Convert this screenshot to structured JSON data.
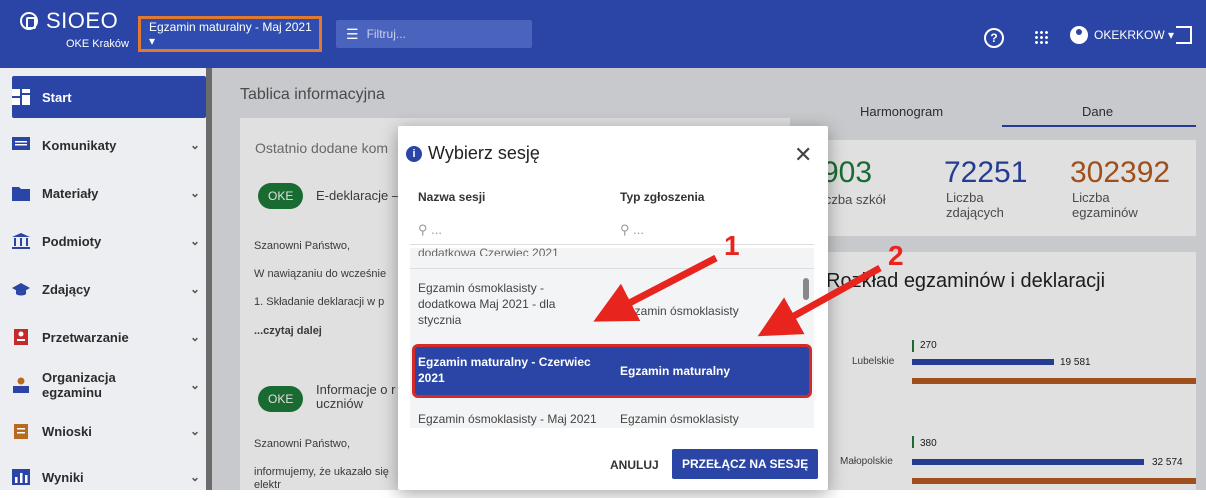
{
  "topbar": {
    "logo_title": "SIOEO",
    "logo_sub": "OKE Kraków",
    "session": "Egzamin maturalny - Maj 2021 ▾",
    "filter_placeholder": "Filtruj...",
    "help_label": "?",
    "user": "OKEKRKOW ▾"
  },
  "sidebar": {
    "items": [
      {
        "label": "Start",
        "icon": "dashboard-icon"
      },
      {
        "label": "Komunikaty",
        "icon": "message-icon"
      },
      {
        "label": "Materiały",
        "icon": "folder-icon"
      },
      {
        "label": "Podmioty",
        "icon": "institution-icon"
      },
      {
        "label": "Zdający",
        "icon": "graduation-icon"
      },
      {
        "label": "Przetwarzanie",
        "icon": "processing-icon"
      },
      {
        "label": "Organizacja egzaminu",
        "icon": "organization-icon"
      },
      {
        "label": "Wnioski",
        "icon": "clipboard-icon"
      },
      {
        "label": "Wyniki",
        "icon": "chart-icon"
      }
    ]
  },
  "main": {
    "title": "Tablica informacyjna",
    "recent": "Ostatnio dodane kom",
    "news1_badge": "OKE",
    "news1_title": "E-deklaracje –",
    "news1_l1": "Szanowni Państwo,",
    "news1_l2": "W nawiązaniu do wcześnie",
    "news1_l3": "1. Składanie deklaracji w p",
    "news1_more": "...czytaj dalej",
    "news2_badge": "OKE",
    "news2_title1": "Informacje o r",
    "news2_title2": "uczniów",
    "news2_l1": "Szanowni Państwo,",
    "news2_l2": "informujemy, że ukazało się",
    "news2_l3": "elektr"
  },
  "right": {
    "tab1": "Harmonogram",
    "tab2": "Dane",
    "stat1_num": "903",
    "stat1_lbl": "iczba szkół",
    "stat2_num": "72251",
    "stat2_lbl": "Liczba zdających",
    "stat3_num": "302392",
    "stat3_lbl": "Liczba egzaminów",
    "chart_title": "Rozkład egzaminów i deklaracji",
    "r1": "Lubelskie",
    "r1a": "270",
    "r1b": "19 581",
    "r2": "Małopolskie",
    "r2a": "380",
    "r2b": "32 574"
  },
  "dialog": {
    "title": "Wybierz sesję",
    "col1": "Nazwa sesji",
    "col2": "Typ zgłoszenia",
    "search1": "...",
    "search2": "...",
    "row0": "dodatkowa Czerwiec 2021",
    "row1_name": "Egzamin ósmoklasisty - dodatkowa Maj 2021 - dla stycznia",
    "row1_type": "Egzamin ósmoklasisty",
    "row2_name": "Egzamin maturalny - Czerwiec 2021",
    "row2_type": "Egzamin maturalny",
    "row3_name": "Egzamin ósmoklasisty - Maj 2021",
    "row3_type": "Egzamin ósmoklasisty",
    "cancel": "ANULUJ",
    "switch": "PRZEŁĄCZ NA SESJĘ"
  },
  "annotations": {
    "one": "1",
    "two": "2"
  },
  "colors": {
    "primary": "#2a45a5",
    "accent": "#e07a30",
    "annotation": "#e8241f",
    "badge": "#1e7a3a"
  }
}
